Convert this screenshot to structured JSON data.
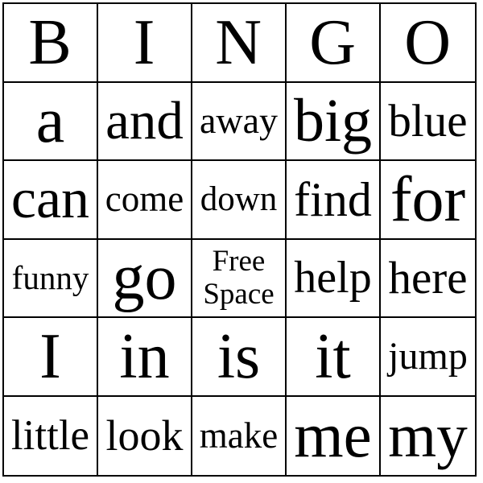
{
  "card": {
    "title": "BINGO",
    "columns": 5,
    "rows": 6,
    "border_color": "#000000",
    "background_color": "#ffffff",
    "text_color": "#000000",
    "header": [
      "B",
      "I",
      "N",
      "G",
      "O"
    ],
    "grid": [
      [
        "a",
        "and",
        "away",
        "big",
        "blue"
      ],
      [
        "can",
        "come",
        "down",
        "find",
        "for"
      ],
      [
        "funny",
        "go",
        "Free Space",
        "help",
        "here"
      ],
      [
        "I",
        "in",
        "is",
        "it",
        "jump"
      ],
      [
        "little",
        "look",
        "make",
        "me",
        "my"
      ]
    ],
    "free_space": {
      "row": 2,
      "column": 2,
      "line1": "Free",
      "line2": "Space"
    }
  }
}
